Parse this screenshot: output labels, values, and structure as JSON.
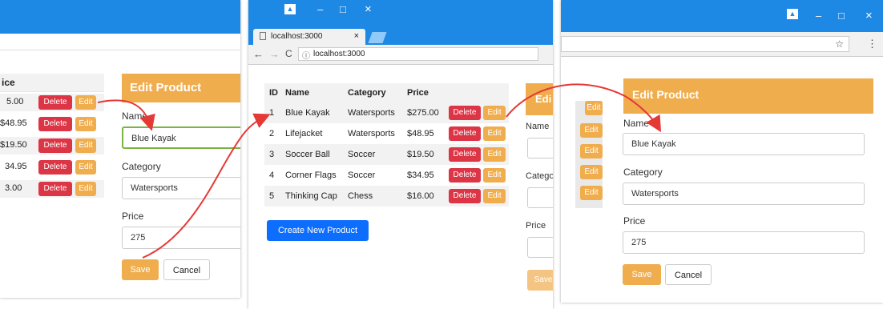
{
  "left": {
    "price_header": "ice",
    "rows": [
      {
        "price": "5.00"
      },
      {
        "price": "$48.95"
      },
      {
        "price": "$19.50"
      },
      {
        "price": "34.95"
      },
      {
        "price": "3.00"
      }
    ],
    "delete_label": "Delete",
    "edit_label": "Edit",
    "panel_title": "Edit Product",
    "name_label": "Name",
    "name_value": "Blue Kayak",
    "category_label": "Category",
    "category_value": "Watersports",
    "price_label": "Price",
    "price_value": "275",
    "save_label": "Save",
    "cancel_label": "Cancel"
  },
  "middle": {
    "tab_title": "localhost:3000",
    "tab_close": "×",
    "address": "localhost:3000",
    "columns": [
      "ID",
      "Name",
      "Category",
      "Price"
    ],
    "rows": [
      {
        "id": "1",
        "name": "Blue Kayak",
        "category": "Watersports",
        "price": "$275.00"
      },
      {
        "id": "2",
        "name": "Lifejacket",
        "category": "Watersports",
        "price": "$48.95"
      },
      {
        "id": "3",
        "name": "Soccer Ball",
        "category": "Soccer",
        "price": "$19.50"
      },
      {
        "id": "4",
        "name": "Corner Flags",
        "category": "Soccer",
        "price": "$34.95"
      },
      {
        "id": "5",
        "name": "Thinking Cap",
        "category": "Chess",
        "price": "$16.00"
      }
    ],
    "delete_label": "Delete",
    "edit_label": "Edit",
    "create_label": "Create New Product",
    "side_panel": "Edi",
    "side_name": "Name",
    "side_category": "Catego",
    "side_price": "Price",
    "side_save": "Save"
  },
  "right": {
    "edit_label": "Edit",
    "panel_title": "Edit Product",
    "name_label": "Name",
    "name_value": "Blue Kayak",
    "category_label": "Category",
    "category_value": "Watersports",
    "price_label": "Price",
    "price_value": "275",
    "save_label": "Save",
    "cancel_label": "Cancel"
  },
  "window_controls": {
    "minimize": "–",
    "maximize": "□",
    "close": "×",
    "star": "☆",
    "menu": "⋮"
  },
  "colors": {
    "titlebar": "#1e88e5",
    "primary": "#0d6efd",
    "danger": "#dc3545",
    "warning": "#f0ad4e",
    "arrow": "#e53935"
  }
}
